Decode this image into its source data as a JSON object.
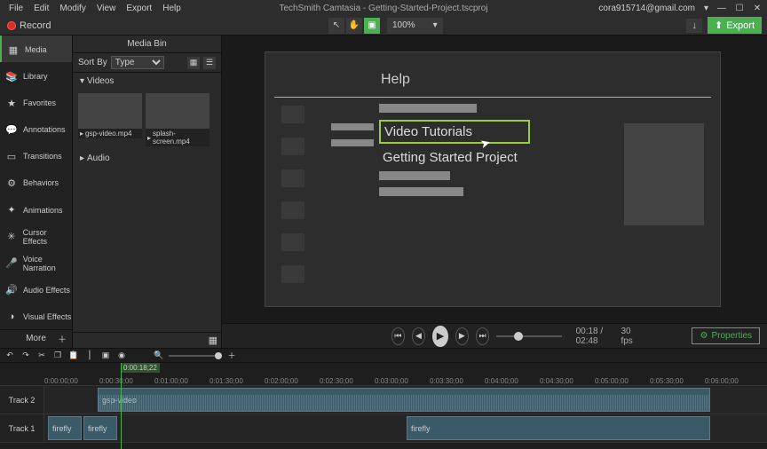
{
  "menubar": {
    "items": [
      "File",
      "Edit",
      "Modify",
      "View",
      "Export",
      "Help"
    ],
    "title": "TechSmith Camtasia - Getting-Started-Project.tscproj",
    "user": "cora915714@gmail.com"
  },
  "toolbar": {
    "record": "Record",
    "zoom": "100%",
    "export": "Export"
  },
  "sidebar": {
    "items": [
      {
        "icon": "▦",
        "label": "Media"
      },
      {
        "icon": "📚",
        "label": "Library"
      },
      {
        "icon": "★",
        "label": "Favorites"
      },
      {
        "icon": "💬",
        "label": "Annotations"
      },
      {
        "icon": "▭",
        "label": "Transitions"
      },
      {
        "icon": "⚙",
        "label": "Behaviors"
      },
      {
        "icon": "✦",
        "label": "Animations"
      },
      {
        "icon": "✳",
        "label": "Cursor Effects"
      },
      {
        "icon": "🎤",
        "label": "Voice Narration"
      },
      {
        "icon": "🔊",
        "label": "Audio Effects"
      },
      {
        "icon": "◑",
        "label": "Visual Effects"
      }
    ],
    "more": "More"
  },
  "mediabin": {
    "title": "Media Bin",
    "sort_label": "Sort By",
    "sort_value": "Type",
    "cat_videos": "Videos",
    "cat_audio": "Audio",
    "thumbs": [
      "gsp-video.mp4",
      "splash-screen.mp4"
    ]
  },
  "preview": {
    "help": "Help",
    "video_tutorials": "Video Tutorials",
    "getting_started": "Getting Started Project"
  },
  "playback": {
    "time": "00:18 / 02:48",
    "fps": "30 fps",
    "properties": "Properties"
  },
  "timeline": {
    "playhead": "0:00:18;22",
    "ticks": [
      "0:00:00;00",
      "0:00:30;00",
      "0:01:00;00",
      "0:01:30;00",
      "0:02:00;00",
      "0:02:30;00",
      "0:03:00;00",
      "0:03:30;00",
      "0:04:00;00",
      "0:04:30;00",
      "0:05:00;00",
      "0:05:30;00",
      "0:06:00;00"
    ],
    "track2_label": "Track 2",
    "track1_label": "Track 1",
    "clip_gsp": "gsp-video",
    "clip_firefly": "firefly"
  }
}
